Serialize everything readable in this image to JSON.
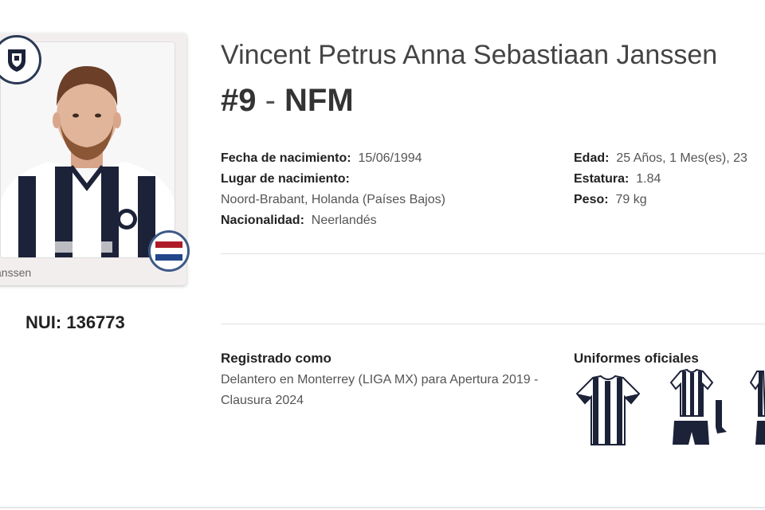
{
  "player": {
    "full_name": "Vincent Petrus Anna Sebastiaan Janssen",
    "number": "#9",
    "separator": " - ",
    "short_name": "NFM",
    "card_caption": "anssen",
    "nui_label": "NUI:",
    "nui_value": "136773"
  },
  "details": {
    "birth_date_label": "Fecha de nacimiento:",
    "birth_date_value": "15/06/1994",
    "birth_place_label": "Lugar de nacimiento:",
    "birth_place_value": "Noord-Brabant, Holanda (Países Bajos)",
    "nationality_label": "Nacionalidad:",
    "nationality_value": "Neerlandés",
    "age_label": "Edad:",
    "age_value": "25 Años, 1 Mes(es), 23",
    "height_label": "Estatura:",
    "height_value": "1.84",
    "weight_label": "Peso:",
    "weight_value": "79 kg"
  },
  "registration": {
    "title": "Registrado como",
    "text": "Delantero en Monterrey (LIGA MX) para Apertura 2019 - Clausura 2024"
  },
  "uniforms": {
    "title": "Uniformes oficiales"
  },
  "colors": {
    "kit_navy": "#1c2238",
    "flag_red": "#ae1c28",
    "flag_blue": "#21468b"
  }
}
